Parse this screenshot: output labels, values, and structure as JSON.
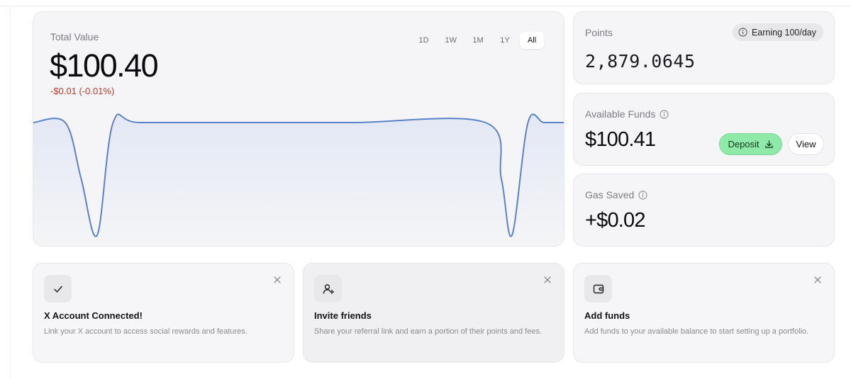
{
  "portfolio": {
    "title": "Total Value",
    "value": "$100.40",
    "change": "-$0.01 (-0.01%)",
    "ranges": [
      "1D",
      "1W",
      "1M",
      "1Y",
      "All"
    ],
    "active_range": "All"
  },
  "chart_data": {
    "type": "area",
    "title": "",
    "xlabel": "",
    "ylabel": "",
    "x": [
      0,
      0.06,
      0.09,
      0.12,
      0.15,
      0.2,
      0.4,
      0.6,
      0.85,
      0.88,
      0.9,
      0.93,
      0.96,
      1.0
    ],
    "series": [
      {
        "values": [
          100.41,
          100.41,
          100.4,
          100.39,
          100.41,
          100.41,
          100.41,
          100.41,
          100.41,
          100.4,
          100.39,
          100.41,
          100.41,
          100.41
        ]
      }
    ],
    "colors": {
      "line": "#5b82c9",
      "fill_top": "#e3e8f5",
      "fill_bottom": "#f5f5f7"
    },
    "grid": false,
    "legend": "none"
  },
  "points": {
    "label": "Points",
    "value": "2,879.0645",
    "earning": "Earning 100/day"
  },
  "funds": {
    "label": "Available Funds",
    "value": "$100.41",
    "deposit_label": "Deposit",
    "view_label": "View",
    "deposit_color": "#8fe9a9"
  },
  "gas": {
    "label": "Gas Saved",
    "value": "+$0.02"
  },
  "tiles": [
    {
      "icon": "check-icon",
      "title": "X Account Connected!",
      "desc": "Link your X account to access social rewards and features."
    },
    {
      "icon": "user-plus-icon",
      "title": "Invite friends",
      "desc": "Share your referral link and earn a portion of their points and fees."
    },
    {
      "icon": "wallet-icon",
      "title": "Add funds",
      "desc": "Add funds to your available balance to start setting up a portfolio."
    }
  ]
}
